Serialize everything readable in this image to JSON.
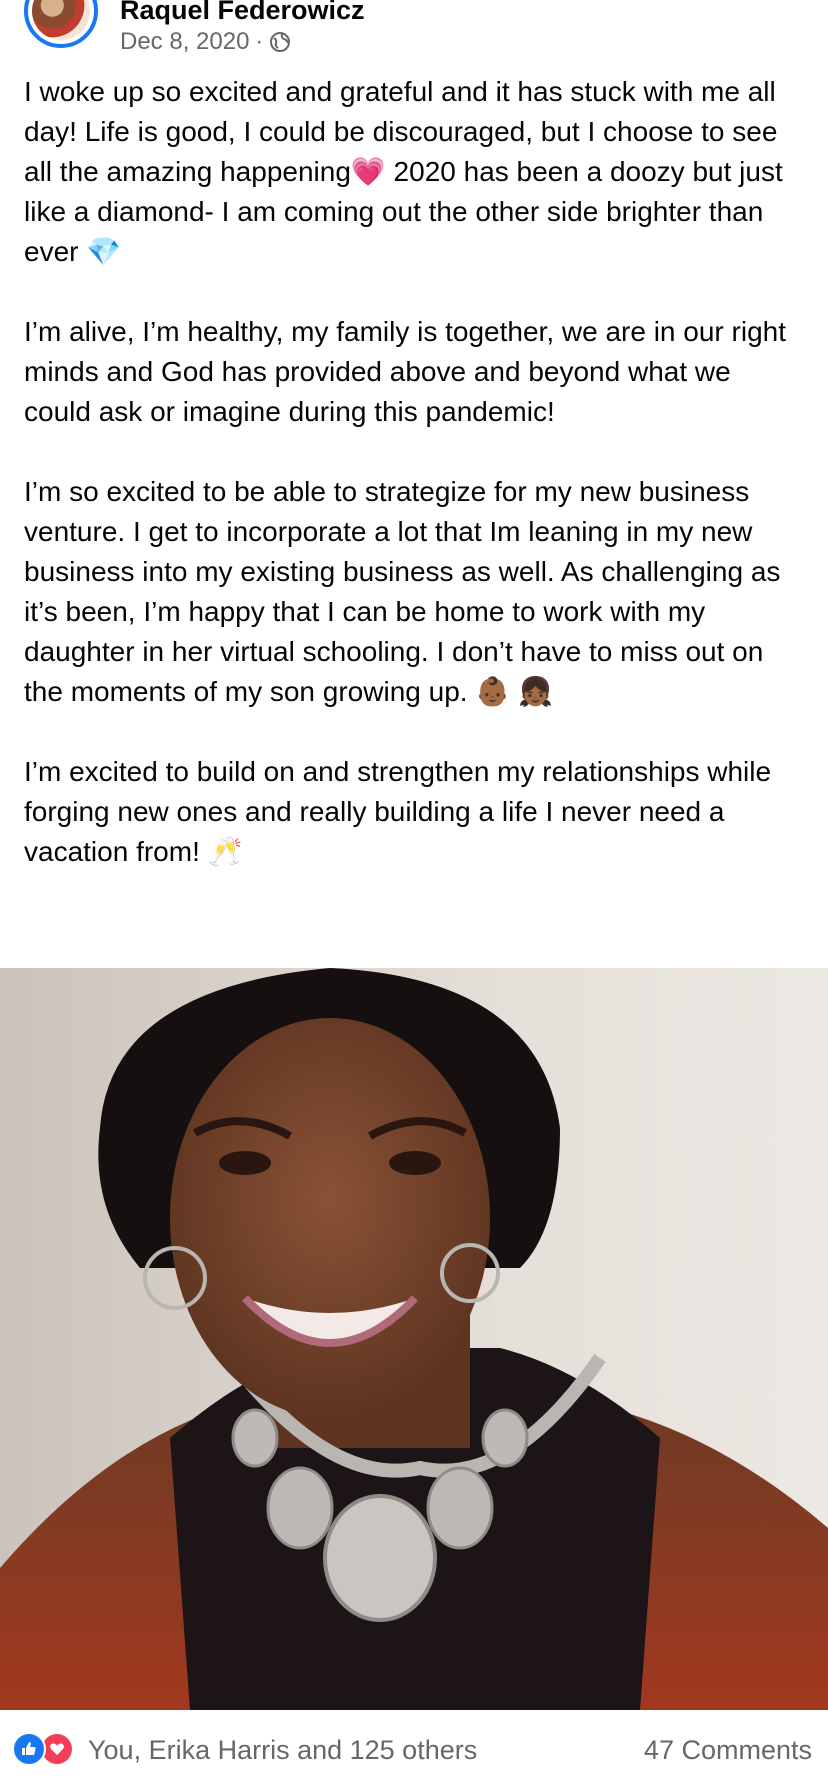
{
  "post": {
    "author": "Raquel Federowicz",
    "date": "Dec 8, 2020",
    "separator": "·",
    "privacy_icon": "globe-icon",
    "paragraphs": [
      "I woke up so excited and grateful and it has stuck with me all day!  Life is good, I could be discouraged, but I choose to see all the amazing happening💗 2020 has been a doozy but just like a diamond- I am coming out the other side brighter than ever 💎",
      "I’m alive, I’m healthy, my family is together, we are in our right minds and God has provided above and beyond what we could ask or imagine during this pandemic!",
      "I’m so excited to be able to strategize for my new business venture.  I get to incorporate a lot that Im leaning in  my new business into my existing business as well. As challenging as it’s been, I’m happy that I can be home to work with my daughter in her virtual schooling. I don’t have to miss out on the moments of my son growing up. 👶🏾 👧🏾",
      "I’m excited to build on and strengthen my relationships while forging new ones and really building a life I never need a vacation from! 🥂"
    ]
  },
  "reactions": {
    "icons": [
      "like-icon",
      "love-icon"
    ],
    "summary": "You, Erika Harris and 125 others",
    "comments": "47 Comments"
  },
  "colors": {
    "brand_blue": "#1877f2",
    "love_red": "#f33e58",
    "secondary_text": "#65676b"
  }
}
